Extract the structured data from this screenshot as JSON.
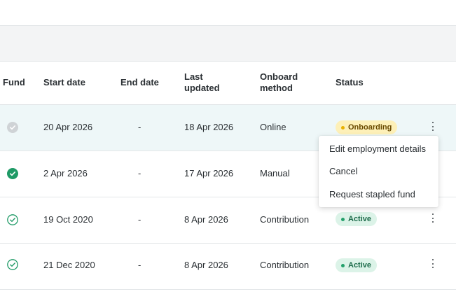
{
  "table": {
    "headers": {
      "fund": "Fund",
      "start_date": "Start date",
      "end_date": "End date",
      "last_updated": "Last updated",
      "onboard_method": "Onboard method",
      "status": "Status"
    },
    "rows": [
      {
        "fund_icon": "grey-check-circle-icon",
        "start_date": "20 Apr 2026",
        "end_date": "-",
        "last_updated": "18 Apr 2026",
        "onboard_method": "Online",
        "status": "Onboarding"
      },
      {
        "fund_icon": "green-filled-check-circle-icon",
        "start_date": "2 Apr 2026",
        "end_date": "-",
        "last_updated": "17 Apr 2026",
        "onboard_method": "Manual",
        "status": ""
      },
      {
        "fund_icon": "green-outline-check-circle-icon",
        "start_date": "19 Oct 2020",
        "end_date": "-",
        "last_updated": "8 Apr 2026",
        "onboard_method": "Contribution",
        "status": "Active"
      },
      {
        "fund_icon": "green-outline-check-circle-icon",
        "start_date": "21 Dec 2020",
        "end_date": "-",
        "last_updated": "8 Apr 2026",
        "onboard_method": "Contribution",
        "status": "Active"
      }
    ]
  },
  "row_menu": {
    "items": [
      "Edit employment details",
      "Cancel",
      "Request stapled fund"
    ]
  },
  "colors": {
    "onboarding_badge_bg": "#fdf0b8",
    "active_badge_bg": "#dcf3e8",
    "selected_row_bg": "#eef7f8",
    "accent_green": "#1f9a66"
  }
}
